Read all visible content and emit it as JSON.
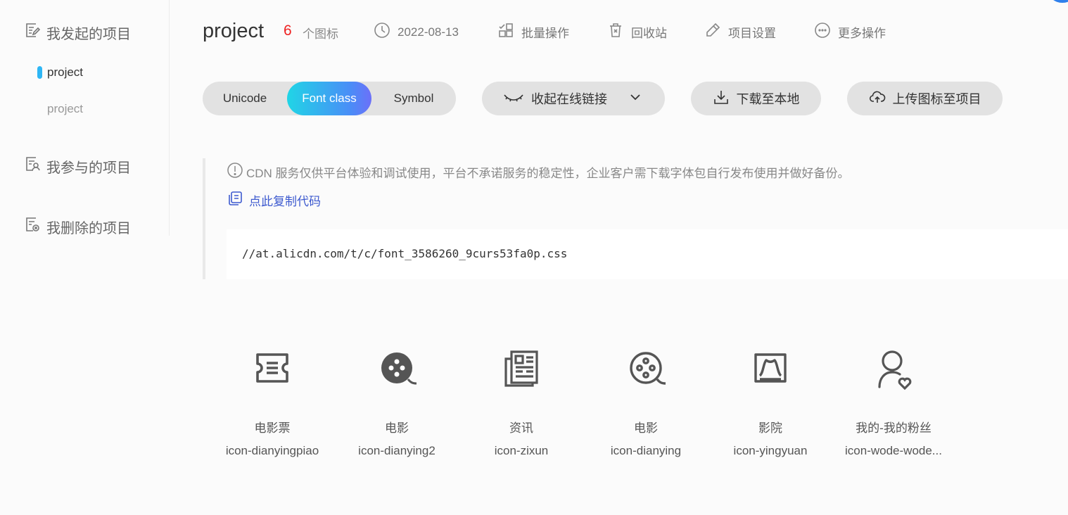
{
  "sidebar": {
    "initiated": {
      "label": "我发起的项目",
      "icon": "doc-edit-icon"
    },
    "projects": [
      {
        "label": "project",
        "active": true
      },
      {
        "label": "project",
        "active": false
      }
    ],
    "joined": {
      "label": "我参与的项目",
      "icon": "doc-user-icon"
    },
    "deleted": {
      "label": "我删除的项目",
      "icon": "doc-delete-icon"
    }
  },
  "header": {
    "title": "project",
    "count": "6",
    "count_unit": "个图标",
    "date": "2022-08-13",
    "batch": "批量操作",
    "recycle": "回收站",
    "settings": "项目设置",
    "more": "更多操作"
  },
  "toolbar": {
    "modes": [
      "Unicode",
      "Font class",
      "Symbol"
    ],
    "active_mode": "Font class",
    "collapse_link": "收起在线链接",
    "download": "下载至本地",
    "upload": "上传图标至项目"
  },
  "notice": {
    "text": "CDN 服务仅供平台体验和调试使用，平台不承诺服务的稳定性，企业客户需下载字体包自行发布使用并做好备份。",
    "copy": "点此复制代码"
  },
  "code": {
    "url": "//at.alicdn.com/t/c/font_3586260_9curs53fa0p.css"
  },
  "icons": [
    {
      "name": "电影票",
      "class": "icon-dianyingpiao",
      "glyph": "ticket-icon"
    },
    {
      "name": "电影",
      "class": "icon-dianying2",
      "glyph": "film-reel-filled-icon"
    },
    {
      "name": "资讯",
      "class": "icon-zixun",
      "glyph": "news-icon"
    },
    {
      "name": "电影",
      "class": "icon-dianying",
      "glyph": "film-reel-outline-icon"
    },
    {
      "name": "影院",
      "class": "icon-yingyuan",
      "glyph": "cinema-screen-icon"
    },
    {
      "name": "我的-我的粉丝",
      "class": "icon-wode-wode...",
      "glyph": "user-heart-icon"
    }
  ],
  "colors": {
    "accent_gradient_start": "#20d5e6",
    "accent_gradient_end": "#6c70f8",
    "count_red": "#ee2222",
    "link_blue": "#3d5acf",
    "active_marker": "#2eb6f5"
  }
}
